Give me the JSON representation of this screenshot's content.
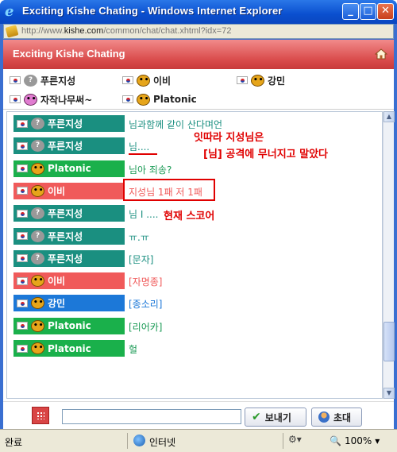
{
  "window": {
    "title": "Exciting Kishe Chating - Windows Internet Explorer",
    "url_prefix": "http://www.",
    "url_domain": "kishe.com",
    "url_suffix": "/common/chat/chat.xhtml?idx=72",
    "minimize": "_",
    "maximize": "□",
    "close": "✕"
  },
  "app": {
    "title": "Exciting Kishe Chating"
  },
  "users": [
    {
      "name": "푸른지성",
      "face": "q"
    },
    {
      "name": "이비",
      "face": "cat"
    },
    {
      "name": "강민",
      "face": "cat"
    },
    {
      "name": "자작나무써~",
      "face": "girl"
    },
    {
      "name": "Platonic",
      "face": "cat"
    }
  ],
  "messages": [
    {
      "user": "푸른지성",
      "face": "q",
      "color": "teal",
      "text": "님과함께 같이 산다며언"
    },
    {
      "user": "푸른지성",
      "face": "q",
      "color": "teal",
      "text": "님...."
    },
    {
      "user": "Platonic",
      "face": "cat",
      "color": "green",
      "text": "님아 죄송?"
    },
    {
      "user": "이비",
      "face": "cat",
      "color": "red",
      "text": "지성님 1패 저 1패"
    },
    {
      "user": "푸른지성",
      "face": "q",
      "color": "teal",
      "text": "님 I ...."
    },
    {
      "user": "푸른지성",
      "face": "q",
      "color": "teal",
      "text": "ㅠ.ㅠ"
    },
    {
      "user": "푸른지성",
      "face": "q",
      "color": "teal",
      "text": "[문자]"
    },
    {
      "user": "이비",
      "face": "cat",
      "color": "red",
      "text": "[자명종]"
    },
    {
      "user": "강민",
      "face": "cat",
      "color": "blue",
      "text": "[종소리]"
    },
    {
      "user": "Platonic",
      "face": "cat",
      "color": "green",
      "text": "[리어카]"
    },
    {
      "user": "Platonic",
      "face": "cat",
      "color": "green",
      "text": "헐"
    }
  ],
  "annotations": {
    "line1": "잇따라 지성님은",
    "line2": "[님] 공격에 무너지고 말았다",
    "line3": "현재 스코어"
  },
  "input": {
    "value": "",
    "send_label": "보내기",
    "invite_label": "초대"
  },
  "statusbar": {
    "status": "완료",
    "zone": "인터넷",
    "zoom": "100%"
  },
  "colors": {
    "teal": "#1a8f80",
    "green": "#1ab04b",
    "red": "#f05a5a",
    "blue": "#1c78d8",
    "header": "#d94a4a",
    "annotation": "#e00000"
  }
}
